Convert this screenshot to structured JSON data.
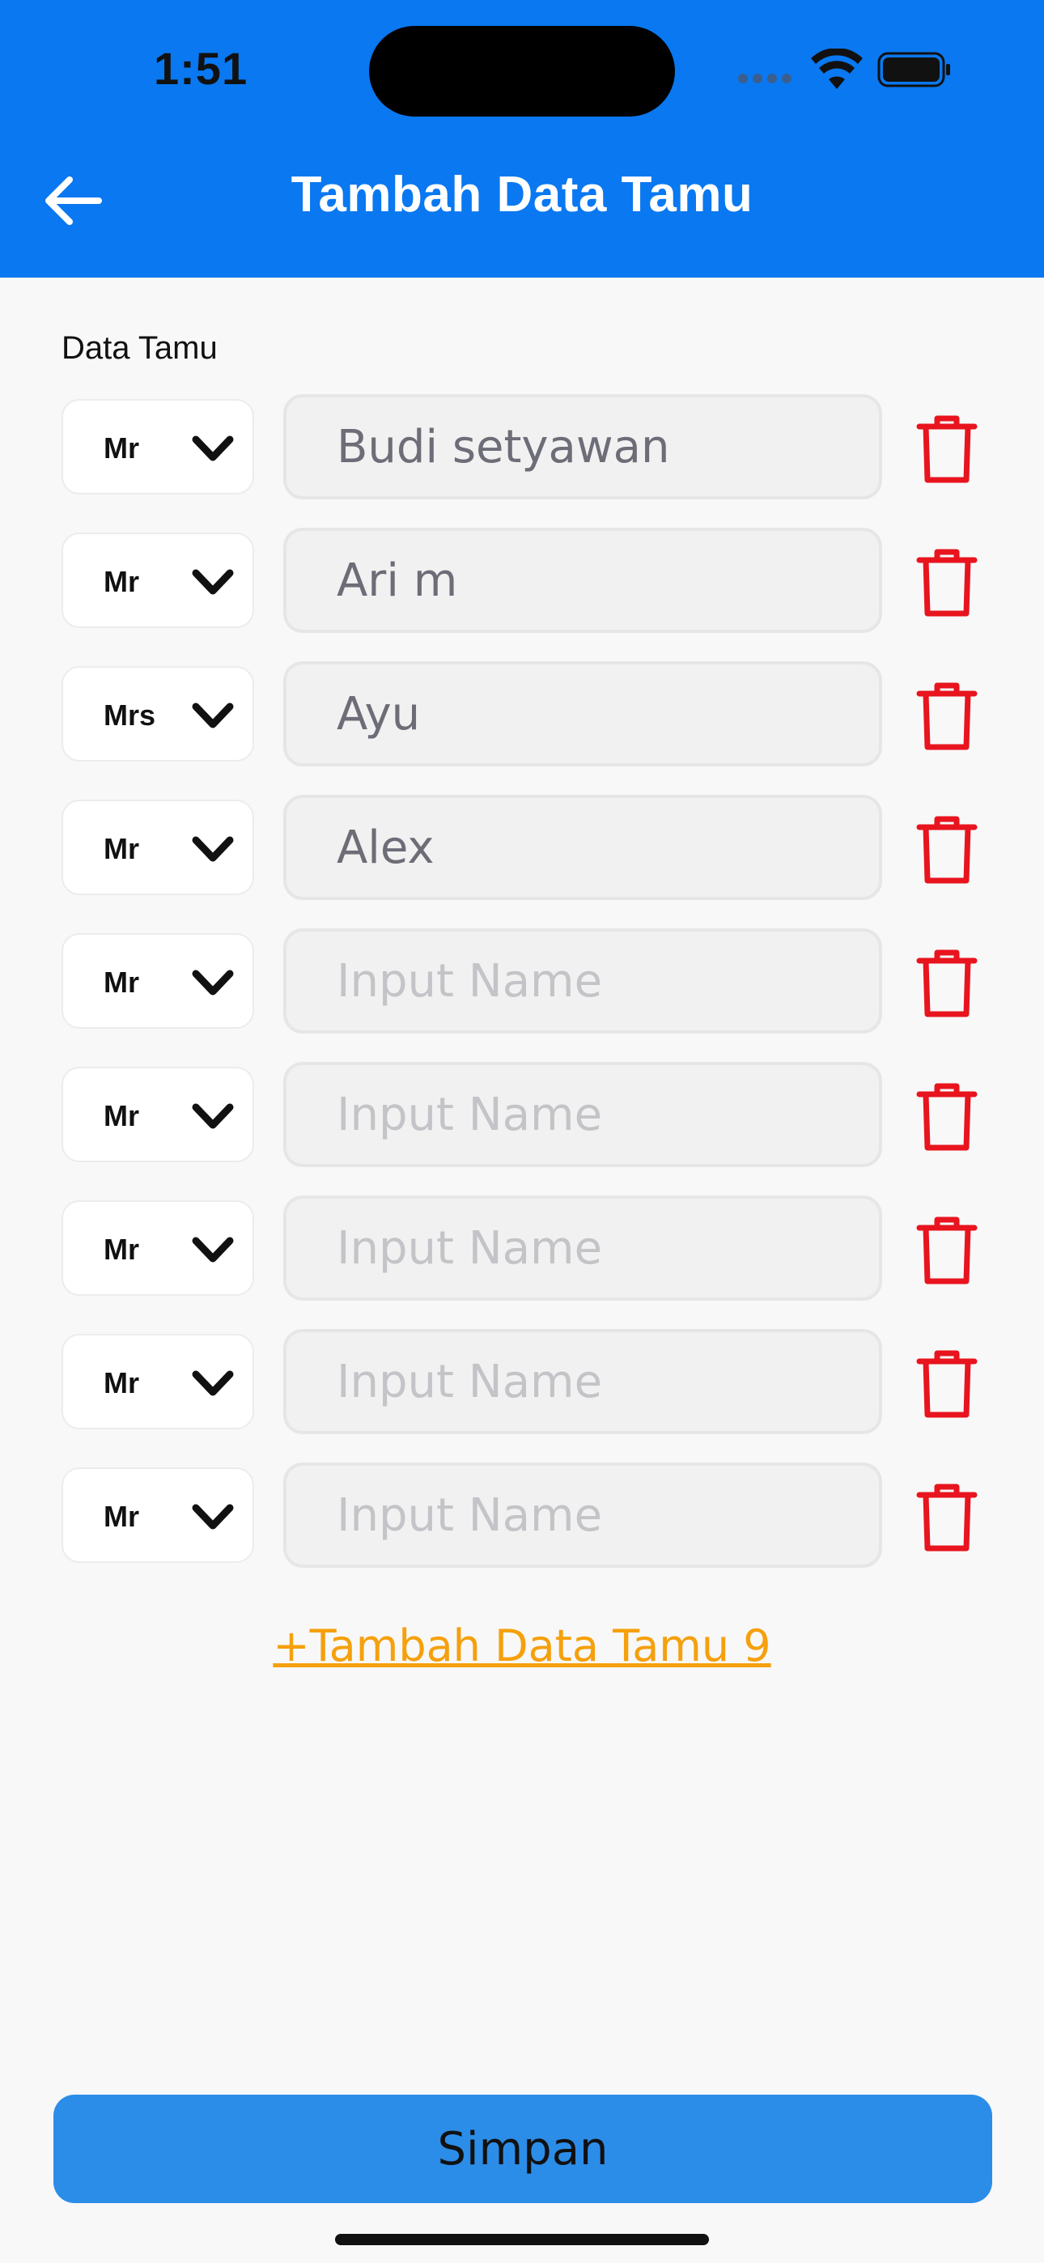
{
  "status_bar": {
    "time": "1:51"
  },
  "header": {
    "title": "Tambah Data Tamu"
  },
  "section_label": "Data Tamu",
  "guests": [
    {
      "prefix": "Mr",
      "name": "Budi setyawan",
      "placeholder": "Input Name"
    },
    {
      "prefix": "Mr",
      "name": "Ari m",
      "placeholder": "Input Name"
    },
    {
      "prefix": "Mrs",
      "name": "Ayu",
      "placeholder": "Input Name"
    },
    {
      "prefix": "Mr",
      "name": "Alex",
      "placeholder": "Input Name"
    },
    {
      "prefix": "Mr",
      "name": "",
      "placeholder": "Input Name"
    },
    {
      "prefix": "Mr",
      "name": "",
      "placeholder": "Input Name"
    },
    {
      "prefix": "Mr",
      "name": "",
      "placeholder": "Input Name"
    },
    {
      "prefix": "Mr",
      "name": "",
      "placeholder": "Input Name"
    },
    {
      "prefix": "Mr",
      "name": "",
      "placeholder": "Input Name"
    }
  ],
  "add_link": "+Tambah Data Tamu 9",
  "save_label": "Simpan",
  "icons": {
    "back": "arrow-left-icon",
    "chevron": "chevron-down-icon",
    "delete": "trash-icon"
  },
  "colors": {
    "header": "#0a78f0",
    "delete": "#e8141e",
    "link": "#f5a00c",
    "save_button": "#2c8de8"
  }
}
